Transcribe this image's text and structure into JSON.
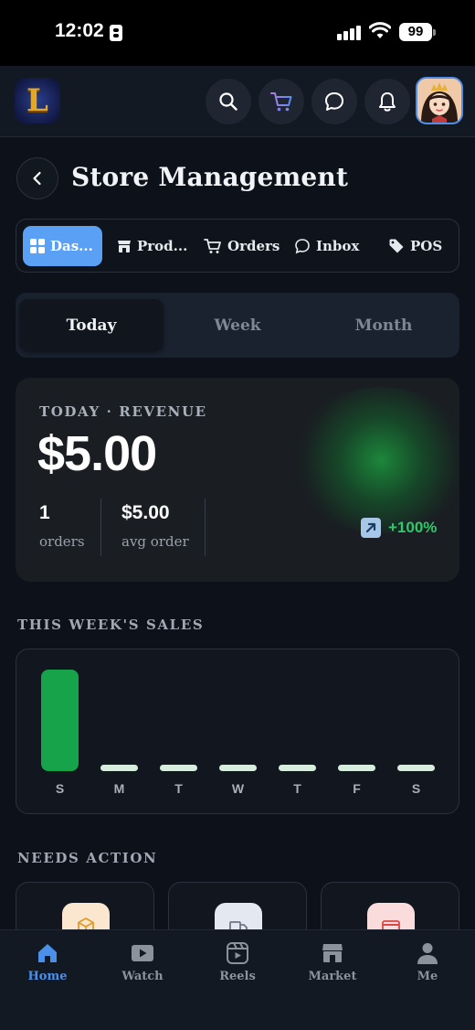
{
  "status_bar": {
    "time": "12:02",
    "battery": "99"
  },
  "app_bar": {
    "logo_letter": "L",
    "icons": [
      "search-icon",
      "cart-icon",
      "chat-icon",
      "bell-icon",
      "avatar"
    ]
  },
  "header": {
    "title": "Store Management"
  },
  "tabs": [
    {
      "label": "Das...",
      "icon": "grid-icon",
      "active": true
    },
    {
      "label": "Prod...",
      "icon": "store-icon",
      "active": false
    },
    {
      "label": "Orders",
      "icon": "cart-icon",
      "active": false
    },
    {
      "label": "Inbox",
      "icon": "chat-icon",
      "active": false
    },
    {
      "label": "POS",
      "icon": "tag-icon",
      "active": false
    }
  ],
  "period": {
    "options": [
      "Today",
      "Week",
      "Month"
    ],
    "selected": "Today"
  },
  "revenue": {
    "label": "TODAY · REVENUE",
    "value": "$5.00",
    "orders_value": "1",
    "orders_label": "orders",
    "avg_value": "$5.00",
    "avg_label": "avg order",
    "change": "+100%"
  },
  "weekly": {
    "title": "THIS WEEK'S SALES",
    "chart_data": {
      "type": "bar",
      "categories": [
        "S",
        "M",
        "T",
        "W",
        "T",
        "F",
        "S"
      ],
      "values": [
        5,
        0,
        0,
        0,
        0,
        0,
        0
      ]
    }
  },
  "needs_action": {
    "title": "NEEDS ACTION",
    "cards": [
      "box-icon",
      "truck-icon",
      "card-icon"
    ]
  },
  "bottom_nav": {
    "items": [
      {
        "label": "Home",
        "icon": "home-icon",
        "active": true
      },
      {
        "label": "Watch",
        "icon": "play-icon",
        "active": false
      },
      {
        "label": "Reels",
        "icon": "reels-icon",
        "active": false
      },
      {
        "label": "Market",
        "icon": "shop-icon",
        "active": false
      },
      {
        "label": "Me",
        "icon": "person-icon",
        "active": false
      }
    ]
  },
  "colors": {
    "accent": "#5aa1f5",
    "positive": "#2ec96b",
    "bar": "#17a34a",
    "nav_active": "#4a90e8"
  }
}
